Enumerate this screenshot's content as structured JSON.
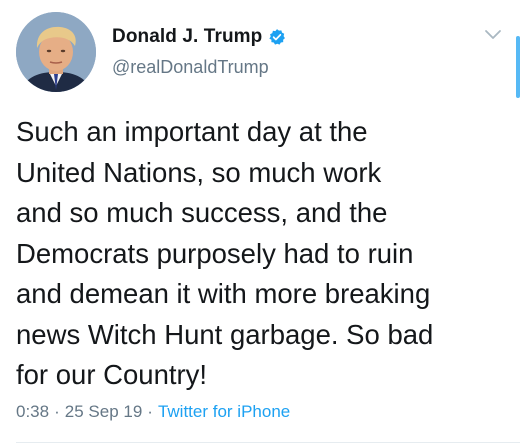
{
  "author": {
    "display_name": "Donald J. Trump",
    "handle": "@realDonaldTrump",
    "verified": true,
    "avatar_icon": "profile-photo"
  },
  "tweet": {
    "text": "Such an important day at the\nUnited Nations, so much work\nand so much success, and the\nDemocrats purposely had to ruin\nand demean it with more breaking\nnews Witch Hunt garbage. So bad\nfor our Country!",
    "time": "0:38",
    "date": "25 Sep 19",
    "separator": "·",
    "source": "Twitter for iPhone"
  },
  "colors": {
    "accent": "#1da1f2",
    "text": "#14171a",
    "muted": "#657786"
  },
  "icons": {
    "verified": "verified-badge-icon",
    "menu": "chevron-down-icon"
  }
}
